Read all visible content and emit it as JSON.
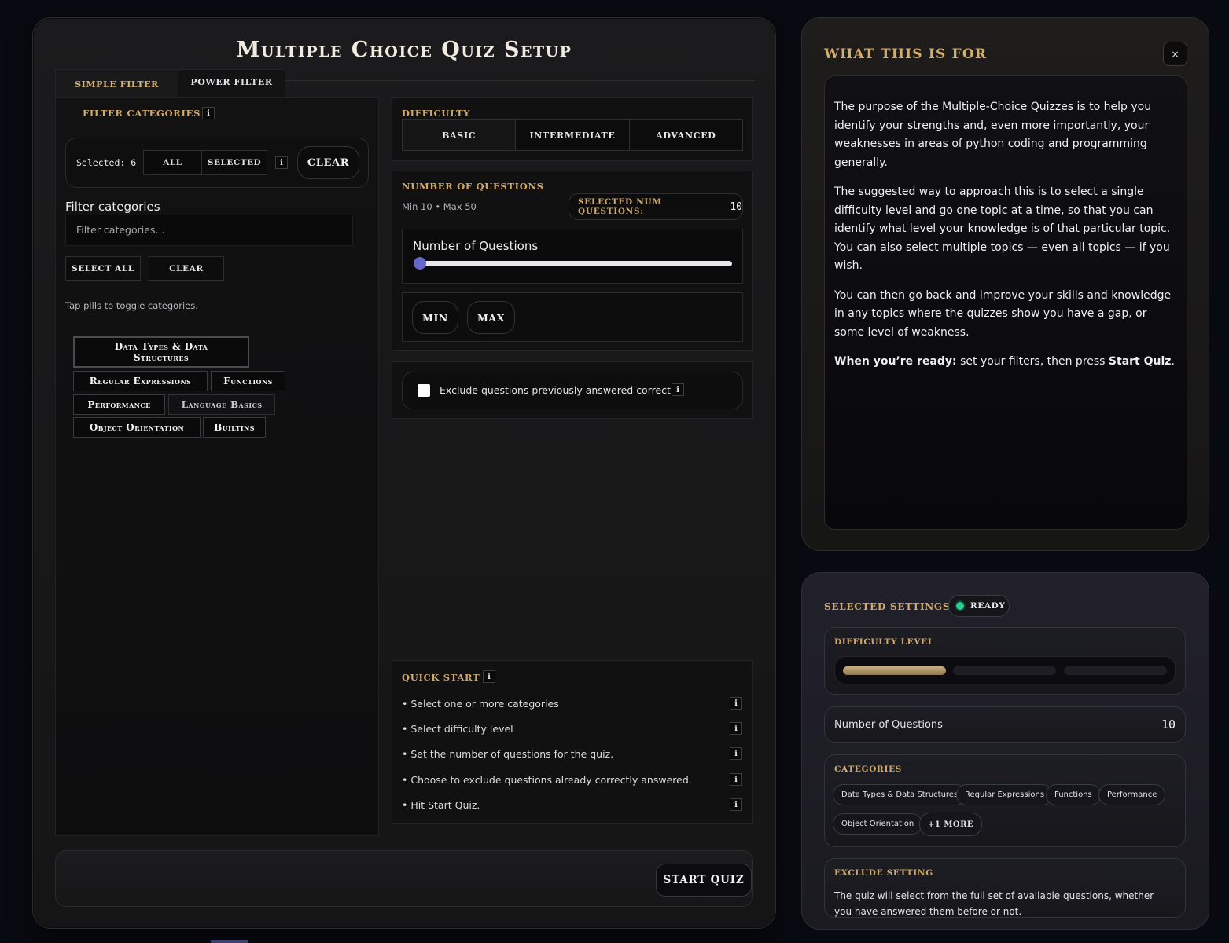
{
  "page_title": "Multiple Choice Quiz Setup",
  "tabs": [
    {
      "label": "Simple Filter",
      "active": true
    },
    {
      "label": "Power Filter",
      "active": false
    }
  ],
  "filter": {
    "section_label": "Filter Categories",
    "selected_text": "Selected: 6",
    "seg_all": "All",
    "seg_selected": "Selected",
    "clear_label": "Clear",
    "field_label": "Filter categories",
    "placeholder": "Filter categories...",
    "select_all_label": "Select All",
    "clear2_label": "Clear",
    "hint": "Tap pills to toggle categories.",
    "chips": [
      {
        "label": "Data Types & Data Structures"
      },
      {
        "label": "Regular Expressions"
      },
      {
        "label": "Functions"
      },
      {
        "label": "Performance"
      },
      {
        "label": "Language Basics"
      },
      {
        "label": "Object Orientation"
      },
      {
        "label": "Builtins"
      }
    ]
  },
  "difficulty": {
    "label": "Difficulty",
    "options": [
      "Basic",
      "Intermediate",
      "Advanced"
    ],
    "selected": "Basic"
  },
  "num_questions": {
    "label": "Number of Questions",
    "range_text": "Min 10 • Max 50",
    "selected_label": "Selected Num Questions:",
    "value": "10",
    "slider_label": "Number of Questions",
    "slider_min": 10,
    "slider_max": 50,
    "slider_value": 10,
    "min_label": "Min",
    "max_label": "Max"
  },
  "exclude": {
    "label": "Exclude questions previously answered correctly",
    "checked": false
  },
  "quick_start": {
    "label": "Quick Start",
    "steps": [
      "• Select one or more categories",
      "• Select difficulty level",
      "• Set the number of questions for the quiz.",
      "• Choose to exclude questions already correctly answered.",
      "• Hit Start Quiz."
    ]
  },
  "start_label": "Start Quiz",
  "info_panel": {
    "title": "What This Is For",
    "close": "×",
    "p1": "The purpose of the Multiple-Choice Quizzes is to help you identify your strengths and, even more importantly, your weaknesses in areas of python coding and programming generally.",
    "p2": "The suggested way to approach this is to select a single difficulty level and go one topic at a time, so that you can identify what level your knowledge is of that particular topic. You can also select multiple topics — even all topics — if you wish.",
    "p3": "You can then go back and improve your skills and knowledge in any topics where the quizzes show you have a gap, or some level of weakness.",
    "p4_bold": "When you’re ready:",
    "p4_text": " set your filters, then press ",
    "p4_bold2": "Start Quiz",
    "p4_end": "."
  },
  "settings": {
    "title": "Selected Settings",
    "ready": "Ready",
    "ready_color": "#2ad08f",
    "difficulty_label": "Difficulty Level",
    "difficulty_level_index": 0,
    "num_label": "Number of Questions",
    "num_value": "10",
    "categories_label": "Categories",
    "categories": [
      "Data Types & Data Structures",
      "Regular Expressions",
      "Functions",
      "Performance",
      "Object Orientation"
    ],
    "more": "+1 More",
    "exclude_label": "Exclude Setting",
    "exclude_text": "The quiz will select from the full set of available questions, whether you have answered them before or not."
  },
  "colors": {
    "accent_gold": "#d3a96a",
    "slider_thumb": "#6567c9",
    "background": "#070a10"
  }
}
